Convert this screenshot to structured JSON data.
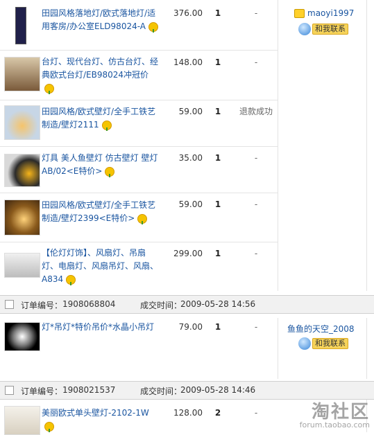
{
  "order_groups": [
    {
      "seller": "maoyi1997",
      "items": [
        {
          "title": "田园风格落地灯/欧式落地灯/适用客房/办公室ELD98024-A",
          "price": "376.00",
          "qty": "1",
          "status": "-",
          "thumb": "floor-lamp"
        },
        {
          "title": "台灯、现代台灯、仿古台灯、经典欧式台灯/EB98024冲冠价",
          "price": "148.00",
          "qty": "1",
          "status": "-",
          "thumb": "table-lamp"
        },
        {
          "title": "田园风格/欧式壁灯/全手工铁艺制造/壁灯2111",
          "price": "59.00",
          "qty": "1",
          "status": "退款成功",
          "thumb": "wall-lamp-iron"
        },
        {
          "title": "灯具 美人鱼壁灯 仿古壁灯 壁灯AB/02<E特价>",
          "price": "35.00",
          "qty": "1",
          "status": "-",
          "thumb": "mermaid-lamp"
        },
        {
          "title": "田园风格/欧式壁灯/全手工铁艺制造/壁灯2399<E特价>",
          "price": "59.00",
          "qty": "1",
          "status": "-",
          "thumb": "wall-lamp-warm"
        },
        {
          "title": "【伦灯灯饰】、风扇灯、吊扇灯、电扇灯、风扇吊灯、风扇、A834",
          "price": "299.00",
          "qty": "1",
          "status": "-",
          "thumb": "ceiling-fan"
        }
      ]
    },
    {
      "order_label": "订单编号：",
      "order_no": "1908068804",
      "time_label": "成交时间：",
      "time": "2009-05-28 14:56",
      "seller": "鱼鱼的天空_2008",
      "items": [
        {
          "title": "灯*吊灯*特价吊价*水晶小吊灯",
          "price": "79.00",
          "qty": "1",
          "status": "-",
          "thumb": "crystal-pendant"
        }
      ]
    },
    {
      "order_label": "订单编号：",
      "order_no": "1908021537",
      "time_label": "成交时间：",
      "time": "2009-05-28 14:46",
      "items": [
        {
          "title": "美丽欧式单头壁灯-2102-1W",
          "price": "128.00",
          "qty": "2",
          "status": "-",
          "thumb": "candle-wall-lamp"
        }
      ]
    }
  ],
  "contact_label": "和我联系",
  "watermark": {
    "big": "淘社区",
    "small": "forum.taobao.com"
  },
  "colors": {
    "link": "#1a55a0",
    "bar_bg": "#f1f1f1",
    "contact_btn": "#f6d35a"
  }
}
